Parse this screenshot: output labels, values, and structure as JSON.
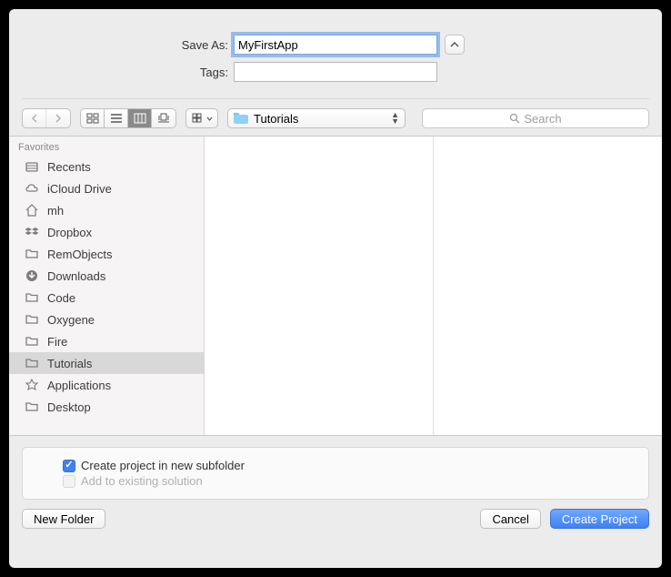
{
  "form": {
    "save_as_label": "Save As:",
    "save_as_value": "MyFirstApp",
    "tags_label": "Tags:",
    "tags_value": ""
  },
  "location": {
    "current_folder": "Tutorials"
  },
  "search": {
    "placeholder": "Search"
  },
  "sidebar": {
    "header": "Favorites",
    "items": [
      {
        "label": "Recents",
        "icon": "recents"
      },
      {
        "label": "iCloud Drive",
        "icon": "icloud"
      },
      {
        "label": "mh",
        "icon": "home"
      },
      {
        "label": "Dropbox",
        "icon": "dropbox"
      },
      {
        "label": "RemObjects",
        "icon": "folder"
      },
      {
        "label": "Downloads",
        "icon": "downloads"
      },
      {
        "label": "Code",
        "icon": "folder"
      },
      {
        "label": "Oxygene",
        "icon": "folder"
      },
      {
        "label": "Fire",
        "icon": "folder"
      },
      {
        "label": "Tutorials",
        "icon": "folder",
        "selected": true
      },
      {
        "label": "Applications",
        "icon": "apps"
      },
      {
        "label": "Desktop",
        "icon": "folder"
      }
    ]
  },
  "options": {
    "create_subfolder_label": "Create project in new subfolder",
    "create_subfolder_checked": true,
    "add_to_solution_label": "Add to existing solution",
    "add_to_solution_enabled": false
  },
  "footer": {
    "new_folder": "New Folder",
    "cancel": "Cancel",
    "create": "Create Project"
  }
}
